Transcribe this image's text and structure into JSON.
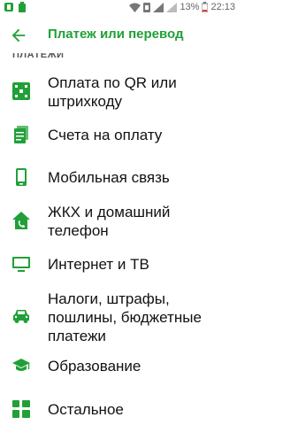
{
  "status": {
    "battery": "13%",
    "time": "22:13"
  },
  "header": {
    "title": "Платеж или перевод"
  },
  "section_title": "ПЛАТЕЖИ",
  "items": [
    {
      "label": "Оплата по QR или штрихкоду",
      "icon": "qr-icon"
    },
    {
      "label": "Счета на оплату",
      "icon": "invoice-icon"
    },
    {
      "label": "Мобильная связь",
      "icon": "phone-icon"
    },
    {
      "label": "ЖКХ и домашний телефон",
      "icon": "house-phone-icon"
    },
    {
      "label": "Интернет и ТВ",
      "icon": "tv-icon"
    },
    {
      "label": "Налоги, штрафы, пошлины, бюджетные платежи",
      "icon": "car-icon"
    },
    {
      "label": "Образование",
      "icon": "graduation-cap-icon"
    },
    {
      "label": "Остальное",
      "icon": "grid-icon"
    }
  ],
  "colors": {
    "accent": "#21a038",
    "text": "#111111"
  }
}
